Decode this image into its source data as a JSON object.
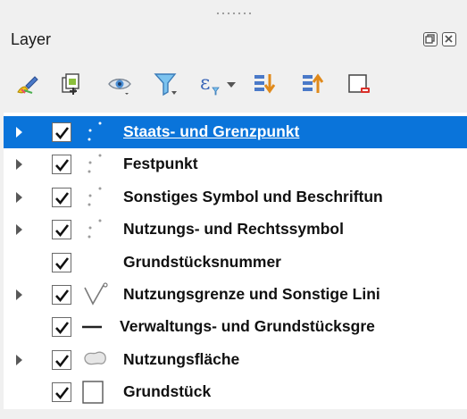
{
  "panel": {
    "title": "Layer",
    "float_icon": "float-window-icon",
    "close_icon": "close-panel-icon"
  },
  "toolbar": {
    "items": [
      {
        "name": "style-manager-icon"
      },
      {
        "name": "add-group-icon"
      },
      {
        "name": "visibility-eye-icon"
      },
      {
        "name": "filter-icon"
      },
      {
        "name": "filter-expression-icon"
      },
      {
        "name": "expand-all-icon"
      },
      {
        "name": "collapse-all-icon"
      },
      {
        "name": "remove-layer-icon"
      }
    ]
  },
  "layers": [
    {
      "label": "Staats- und Grenzpunkt",
      "checked": true,
      "expandable": true,
      "selected": true,
      "symbol": "point-dots-icon"
    },
    {
      "label": "Festpunkt",
      "checked": true,
      "expandable": true,
      "selected": false,
      "symbol": "point-dots-icon"
    },
    {
      "label": "Sonstiges Symbol und Beschriftun",
      "checked": true,
      "expandable": true,
      "selected": false,
      "symbol": "point-dots-icon"
    },
    {
      "label": "Nutzungs- und Rechtssymbol",
      "checked": true,
      "expandable": true,
      "selected": false,
      "symbol": "point-dots-icon"
    },
    {
      "label": "Grundstücksnummer",
      "checked": true,
      "expandable": false,
      "selected": false,
      "symbol": "none"
    },
    {
      "label": "Nutzungsgrenze und Sonstige Lini",
      "checked": true,
      "expandable": true,
      "selected": false,
      "symbol": "line-categorized-icon"
    },
    {
      "label": "Verwaltungs- und Grundstücksgre",
      "checked": true,
      "expandable": false,
      "selected": false,
      "symbol": "line-simple-icon"
    },
    {
      "label": "Nutzungsfläche",
      "checked": true,
      "expandable": true,
      "selected": false,
      "symbol": "polygon-categorized-icon"
    },
    {
      "label": "Grundstück",
      "checked": true,
      "expandable": false,
      "selected": false,
      "symbol": "polygon-simple-icon"
    }
  ],
  "colors": {
    "selection": "#0a74da",
    "panel_bg": "#f0f0f0",
    "tree_bg": "#ffffff"
  }
}
